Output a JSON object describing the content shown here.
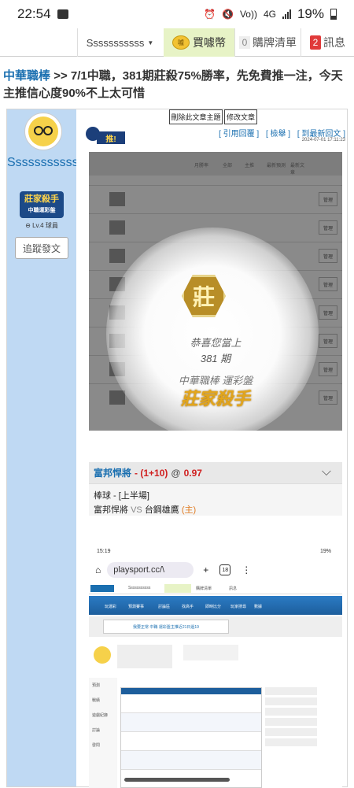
{
  "status": {
    "time": "22:54",
    "battery": "19%",
    "network": "4G",
    "volte": "Vo))"
  },
  "nav": {
    "username": "Sssssssssss",
    "coin_label": "買噱幣",
    "coin_icon": "coin-icon",
    "cart_label": "購牌清單",
    "cart_count": "0",
    "msg_label": "訊息",
    "msg_count": "2"
  },
  "title": {
    "forum": "中華職棒",
    "sep": ">>",
    "text": "7/1中職，381期莊殺75%勝率，先免費推一注，今天主推信心度90%不上太可惜"
  },
  "author": {
    "name": "Sssssssssss",
    "badge": "莊家殺手",
    "badge_sub": "中職運彩盤",
    "level": "Lv.4 球員",
    "follow": "追蹤發文"
  },
  "post": {
    "delete_btn": "刪除此文章主題",
    "edit_btn": "修改文章",
    "link_quote": "[ 引用回覆 ]",
    "link_report": "[ 檢舉 ]",
    "link_latest": "[ 到最新回文 ]",
    "date": "2024-07-01 17:11:23",
    "push_label": "推!"
  },
  "overlay": {
    "head_cols": [
      "月勝率",
      "全部",
      "主推",
      "最新預測",
      "最新文章"
    ],
    "manage": "管理",
    "emblem": "莊",
    "congrats": "恭喜您當上",
    "period": "381 期",
    "league": "中華職棒 運彩盤",
    "award": "莊家殺手"
  },
  "game": {
    "team": "富邦悍將",
    "pick": "- (1+10)",
    "at": "@",
    "odds": "0.97",
    "line1": "棒球 - [上半場]",
    "away": "富邦悍將",
    "vs": "VS",
    "home": "台鋼雄鷹",
    "home_tag": "(主)"
  },
  "shot": {
    "time": "15:19",
    "battery": "19%",
    "url": "playsport.cc/\\",
    "tabs": "18",
    "username": "Sssssssssss",
    "coin": "買噱幣",
    "cart": "購牌清單",
    "msg": "訊息",
    "ticker": "我要正常 中職 運彩盤主推近21日過19",
    "menu": [
      "玩運彩",
      "預測賽事",
      "討論區",
      "找高手",
      "即時比分",
      "玩家搜尋",
      "數據"
    ],
    "side": [
      "預測",
      "戰績",
      "遊戲紀錄",
      "討論",
      "發問"
    ]
  }
}
